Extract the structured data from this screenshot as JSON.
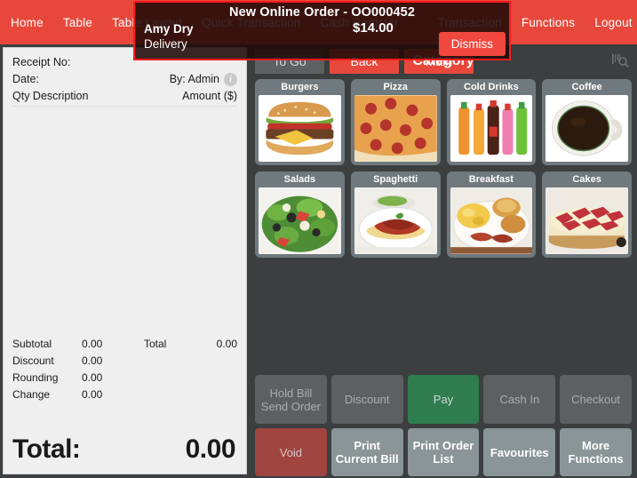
{
  "nav": {
    "items": [
      {
        "label": "Home"
      },
      {
        "label": "Table"
      },
      {
        "label": "Table Layout"
      },
      {
        "label": "Quick Transaction"
      },
      {
        "label": "Cash Register"
      },
      {
        "label": "Transaction"
      },
      {
        "label": "Functions"
      },
      {
        "label": "Logout"
      }
    ]
  },
  "receipt": {
    "receipt_no_label": "Receipt No:",
    "receipt_no_value": "",
    "date_label": "Date:",
    "date_value": "",
    "by_label": "By: Admin",
    "info_icon": "i",
    "col_qty": "Qty  Description",
    "col_amount": "Amount ($)",
    "totals": [
      {
        "label": "Subtotal",
        "value": "0.00"
      },
      {
        "label": "Discount",
        "value": "0.00"
      },
      {
        "label": "Rounding",
        "value": "0.00"
      },
      {
        "label": "Change",
        "value": "0.00"
      }
    ],
    "total_side_label": "Total",
    "total_side_value": "0.00",
    "grand_label": "Total:",
    "grand_value": "0.00"
  },
  "category_panel": {
    "togo_label": "To Go",
    "back_label": "Back",
    "main_label": "Main",
    "title": "Category",
    "scan_icon": "barcode-search-icon",
    "tiles": [
      {
        "label": "Burgers",
        "image": "burger-image"
      },
      {
        "label": "Pizza",
        "image": "pizza-image"
      },
      {
        "label": "Cold Drinks",
        "image": "cold-drinks-image"
      },
      {
        "label": "Coffee",
        "image": "coffee-image"
      },
      {
        "label": "Salads",
        "image": "salad-image"
      },
      {
        "label": "Spaghetti",
        "image": "spaghetti-image"
      },
      {
        "label": "Breakfast",
        "image": "breakfast-image"
      },
      {
        "label": "Cakes",
        "image": "cake-image"
      }
    ]
  },
  "actions": {
    "buttons": [
      {
        "label": "Hold Bill\nSend Order",
        "style": "disabled",
        "name": "hold-bill-send-order-button"
      },
      {
        "label": "Discount",
        "style": "disabled",
        "name": "discount-button"
      },
      {
        "label": "Pay",
        "style": "green",
        "name": "pay-button"
      },
      {
        "label": "Cash In",
        "style": "disabled",
        "name": "cash-in-button"
      },
      {
        "label": "Checkout",
        "style": "disabled",
        "name": "checkout-button"
      },
      {
        "label": "Void",
        "style": "red",
        "name": "void-button"
      },
      {
        "label": "Print\nCurrent Bill",
        "style": "slate",
        "name": "print-current-bill-button"
      },
      {
        "label": "Print Order\nList",
        "style": "slate",
        "name": "print-order-list-button"
      },
      {
        "label": "Favourites",
        "style": "slate",
        "name": "favourites-button"
      },
      {
        "label": "More\nFunctions",
        "style": "slate",
        "name": "more-functions-button"
      }
    ]
  },
  "notification": {
    "title": "New Online Order - OO000452",
    "customer_name": "Amy Dry",
    "order_type": "Delivery",
    "amount": "$14.00",
    "dismiss_label": "Dismiss"
  },
  "colors": {
    "brand_red": "#e8483c",
    "pay_green": "#2f7d4f",
    "void_red": "#a04440",
    "tile_slate": "#70797d",
    "panel_bg": "#3b3f3f",
    "alert_border": "#ff1a1a"
  }
}
